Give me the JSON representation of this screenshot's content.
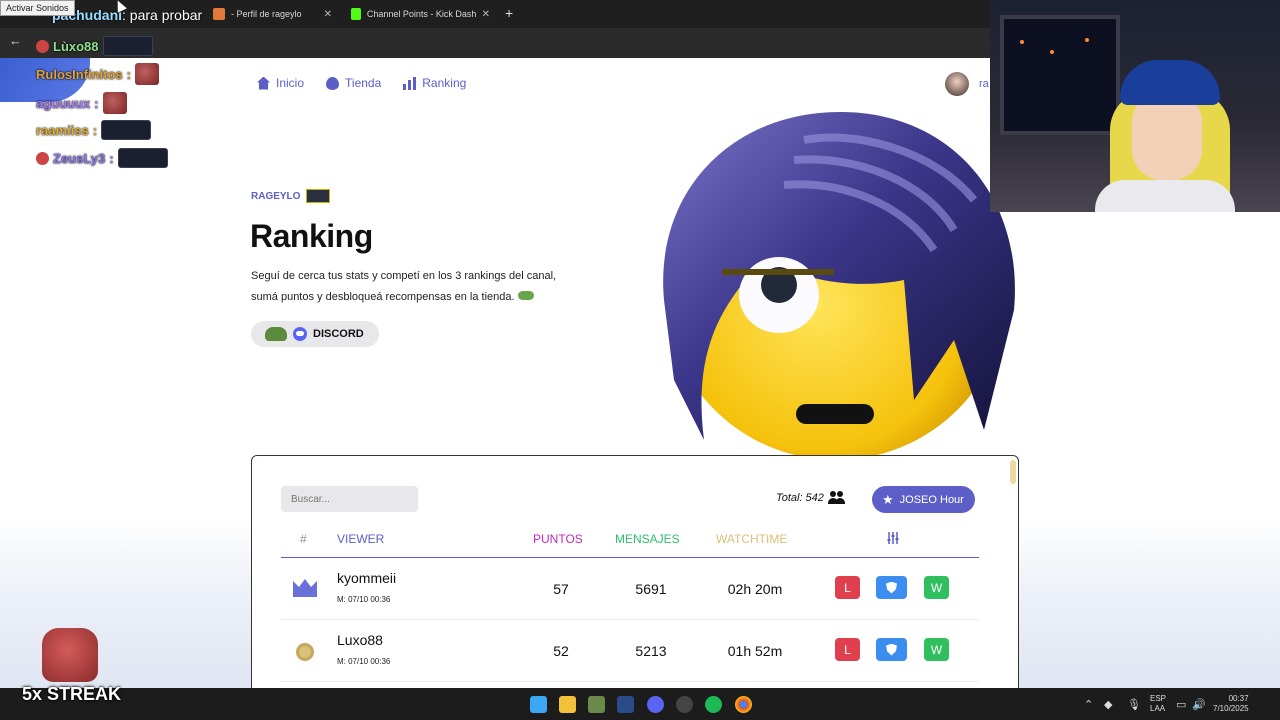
{
  "browser": {
    "tabs": [
      {
        "title": "- Perfil de rageylo",
        "favicon": "ranking-favicon"
      },
      {
        "title": "Channel Points - Kick Dashboard",
        "favicon": "kick-favicon",
        "favicon_color": "#53fc18"
      }
    ],
    "new_tab": "+",
    "back": "←"
  },
  "overlay": {
    "sound_badge": "Activar Sonidos",
    "top_chat": {
      "user": "pachudani",
      "message": ": para probar"
    },
    "chat_lines": [
      {
        "user": "Lùxo88",
        "color": "#8fe08f"
      },
      {
        "user": "RulosInfinitos",
        "color": "#e0a13a",
        "suffix": ":"
      },
      {
        "user": "aguuuux",
        "color": "#a27cf5",
        "suffix": ":"
      },
      {
        "user": "raamiiss",
        "color": "#e2b03a",
        "suffix": ":"
      },
      {
        "user": "ZeusLy3",
        "color": "#8b7be8",
        "suffix": ":"
      }
    ],
    "streak": "5x STREAK"
  },
  "nav": {
    "items": [
      {
        "label": "Inicio",
        "icon": "home-icon"
      },
      {
        "label": "Tienda",
        "icon": "fire-icon"
      },
      {
        "label": "Ranking",
        "icon": "bar-chart-icon"
      }
    ],
    "user_short": "ra"
  },
  "hero": {
    "eyebrow": "RAGEYLO",
    "title": "Ranking",
    "description": "Seguí de cerca tus stats y competí en los 3 rankings del canal, sumá puntos y desbloqueá recompensas en la tienda.",
    "discord_label": "DISCORD"
  },
  "table": {
    "search_placeholder": "Buscar...",
    "total_label": "Total: 542",
    "joseo_label": "JOSEO Hour",
    "headers": {
      "rank": "#",
      "viewer": "VIEWER",
      "puntos": "PUNTOS",
      "mensajes": "MENSAJES",
      "watchtime": "WATCHTIME"
    },
    "rows": [
      {
        "rank_icon": "crown-icon",
        "name": "kyommeii",
        "date": "M: 07/10 00:36",
        "puntos": "57",
        "mensajes": "5691",
        "watchtime": "02h 20m",
        "btn_l": "L",
        "btn_w": "W"
      },
      {
        "rank_icon": "medal-icon",
        "name": "Luxo88",
        "date": "M: 07/10 00:36",
        "puntos": "52",
        "mensajes": "5213",
        "watchtime": "01h 52m",
        "btn_l": "L",
        "btn_w": "W"
      }
    ]
  },
  "taskbar": {
    "lang_top": "ESP",
    "lang_bottom": "LAA",
    "time": "00:37",
    "date": "7/10/2025"
  },
  "colors": {
    "accent": "#5b5fc7",
    "puntos": "#c02ac0",
    "mensajes": "#2cbf6c",
    "watchtime": "#d8c078",
    "btn_l": "#e0404e",
    "btn_shield": "#3c8df0",
    "btn_w": "#2fbf5f"
  }
}
